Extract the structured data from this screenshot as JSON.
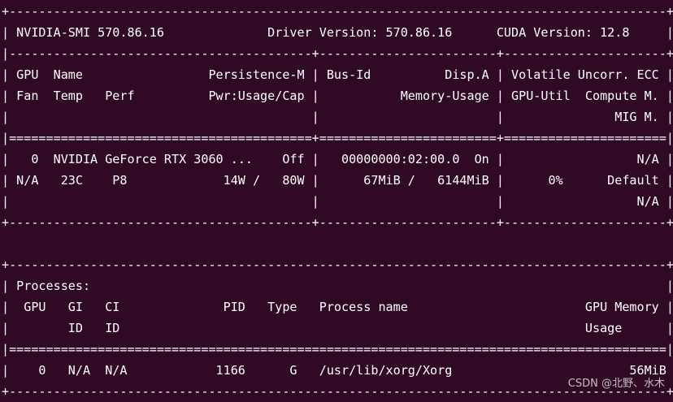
{
  "terminal": {
    "background": "#300a24",
    "foreground": "#ffffff",
    "lines": [
      "+-----------------------------------------------------------------------------------------+",
      "| NVIDIA-SMI 570.86.16              Driver Version: 570.86.16      CUDA Version: 12.8     |",
      "|-----------------------------------------+------------------------+----------------------+",
      "| GPU  Name                 Persistence-M | Bus-Id          Disp.A | Volatile Uncorr. ECC |",
      "| Fan  Temp   Perf          Pwr:Usage/Cap |           Memory-Usage | GPU-Util  Compute M. |",
      "|                                         |                        |               MIG M. |",
      "|=========================================+========================+======================|",
      "|   0  NVIDIA GeForce RTX 3060 ...    Off |   00000000:02:00.0  On |                  N/A |",
      "| N/A   23C    P8             14W /   80W |      67MiB /   6144MiB |      0%      Default |",
      "|                                         |                        |                  N/A |",
      "+-----------------------------------------+------------------------+----------------------+",
      "",
      "+-----------------------------------------------------------------------------------------+",
      "| Processes:                                                                              |",
      "|  GPU   GI   CI              PID   Type   Process name                        GPU Memory |",
      "|        ID   ID                                                               Usage      |",
      "|=========================================================================================|",
      "|    0   N/A  N/A            1166      G   /usr/lib/xorg/Xorg                        56MiB |",
      "+-----------------------------------------------------------------------------------------+"
    ],
    "watermark": "CSDN @北野、水木"
  }
}
